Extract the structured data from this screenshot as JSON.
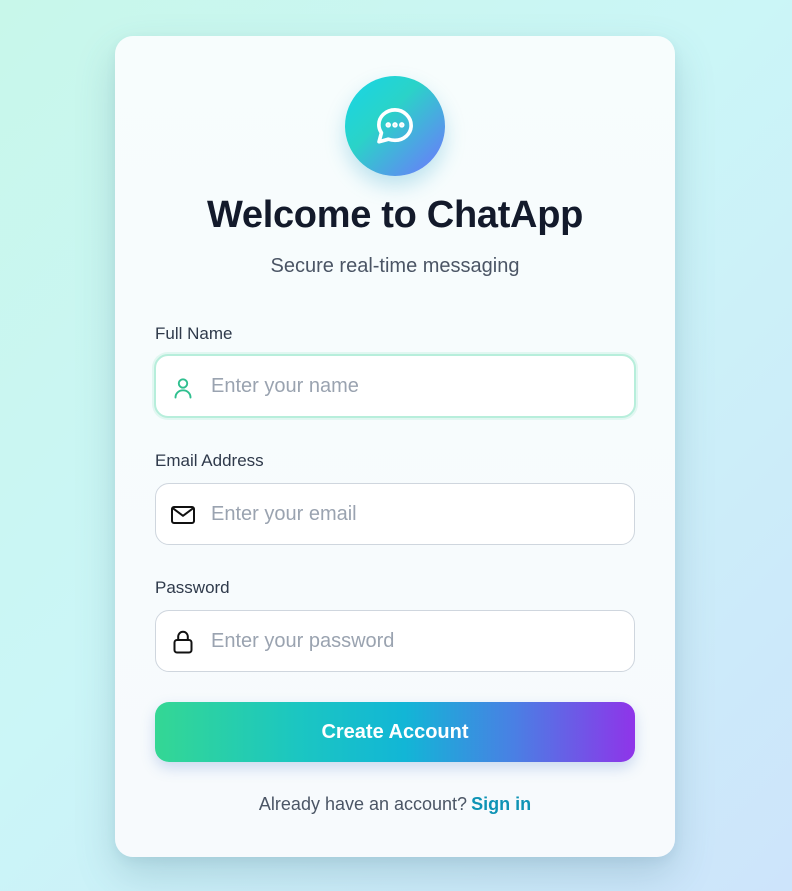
{
  "header": {
    "logo_icon": "chat-bubble-icon",
    "title": "Welcome to ChatApp",
    "subtitle": "Secure real-time messaging"
  },
  "form": {
    "name": {
      "label": "Full Name",
      "placeholder": "Enter your name",
      "value": "",
      "icon": "user-icon"
    },
    "email": {
      "label": "Email Address",
      "placeholder": "Enter your email",
      "value": "",
      "icon": "mail-icon"
    },
    "password": {
      "label": "Password",
      "placeholder": "Enter your password",
      "value": "",
      "icon": "lock-icon"
    },
    "submit_label": "Create Account"
  },
  "footer": {
    "prompt": "Already have an account?",
    "link_label": "Sign in"
  },
  "colors": {
    "accent": "#0e93b5",
    "focus_border": "#b7eedb",
    "title": "#131a2b"
  }
}
